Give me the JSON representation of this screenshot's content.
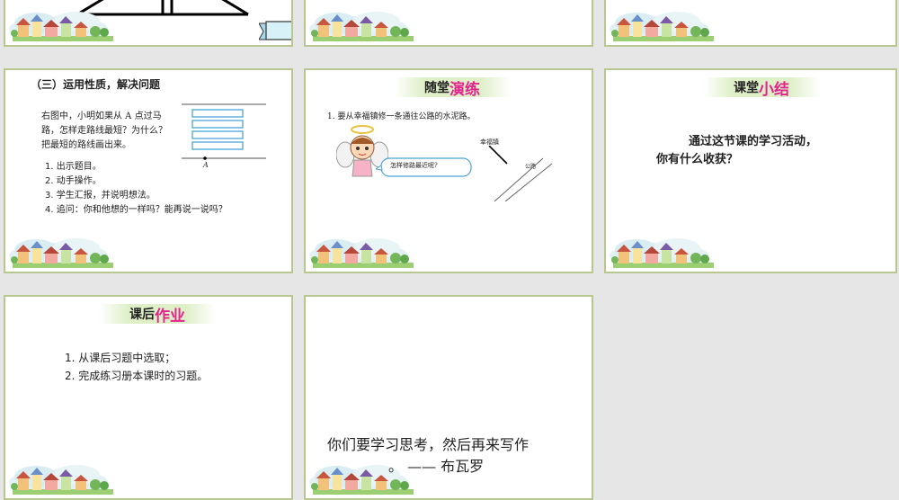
{
  "slide4": {
    "heading": "（三）运用性质，解决问题",
    "question": [
      "右图中，小明如果从 A 点过马",
      "路，怎样走路线最短？为什么？",
      "把最短的路线画出来。"
    ],
    "steps": [
      "1. 出示题目。",
      "2. 动手操作。",
      "3. 学生汇报，并说明想法。",
      "4. 追问：你和他想的一样吗？能再说一说吗？"
    ],
    "point_label": "A"
  },
  "slide5": {
    "title_a": "随堂",
    "title_b": "演练",
    "question": "1. 要从幸福镇修一条通往公路的水泥路。",
    "bubble": "怎样修路最近呢?",
    "town_label": "幸福镇",
    "road_label": "公路"
  },
  "slide6": {
    "title_a": "课堂",
    "title_b": "小结",
    "line1": "通过这节课的学习活动，",
    "line2": "你有什么收获？"
  },
  "slide7": {
    "title_a": "课后",
    "title_b": "作业",
    "items": [
      "1.  从课后习题中选取；",
      "2.  完成练习册本课时的习题。"
    ]
  },
  "slide8": {
    "quote_line1": "你们要学习思考，然后再来写作",
    "quote_line2": "。 ——  布瓦罗"
  },
  "colors": {
    "border": "#b7c78f",
    "accent": "#e2248f",
    "diagram_blue": "#4aa3d8"
  },
  "icons": [
    "town-illustration-icon",
    "angel-cartoon-icon",
    "ribbon-icon"
  ]
}
